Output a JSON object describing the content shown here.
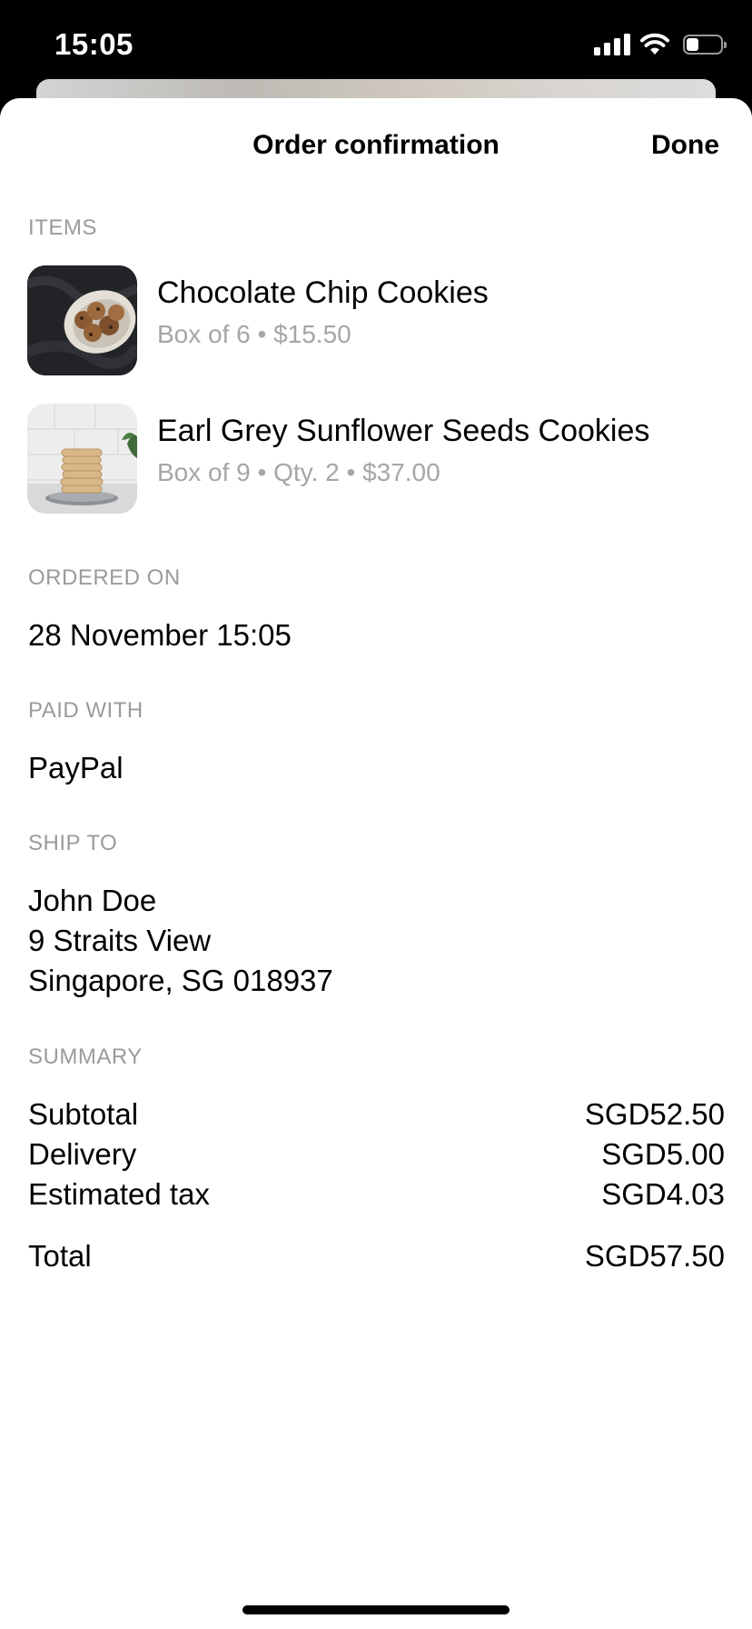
{
  "status_bar": {
    "time": "15:05",
    "icons": [
      "cellular-signal-icon",
      "wifi-icon",
      "battery-icon"
    ],
    "battery_level": 0.35
  },
  "nav": {
    "title": "Order confirmation",
    "done_label": "Done"
  },
  "items_section": {
    "label": "ITEMS",
    "items": [
      {
        "name": "Chocolate Chip Cookies",
        "meta": "Box of 6 • $15.50"
      },
      {
        "name": "Earl Grey Sunflower Seeds Cookies",
        "meta": "Box of 9 • Qty. 2 • $37.00"
      }
    ]
  },
  "ordered_on": {
    "label": "ORDERED ON",
    "value": "28 November 15:05"
  },
  "paid_with": {
    "label": "PAID WITH",
    "value": "PayPal"
  },
  "ship_to": {
    "label": "SHIP TO",
    "lines": [
      "John Doe",
      "9 Straits View",
      "Singapore, SG 018937"
    ]
  },
  "summary": {
    "label": "SUMMARY",
    "rows": [
      {
        "label": "Subtotal",
        "amount": "SGD52.50"
      },
      {
        "label": "Delivery",
        "amount": "SGD5.00"
      },
      {
        "label": "Estimated tax",
        "amount": "SGD4.03"
      }
    ],
    "total": {
      "label": "Total",
      "amount": "SGD57.50"
    }
  }
}
